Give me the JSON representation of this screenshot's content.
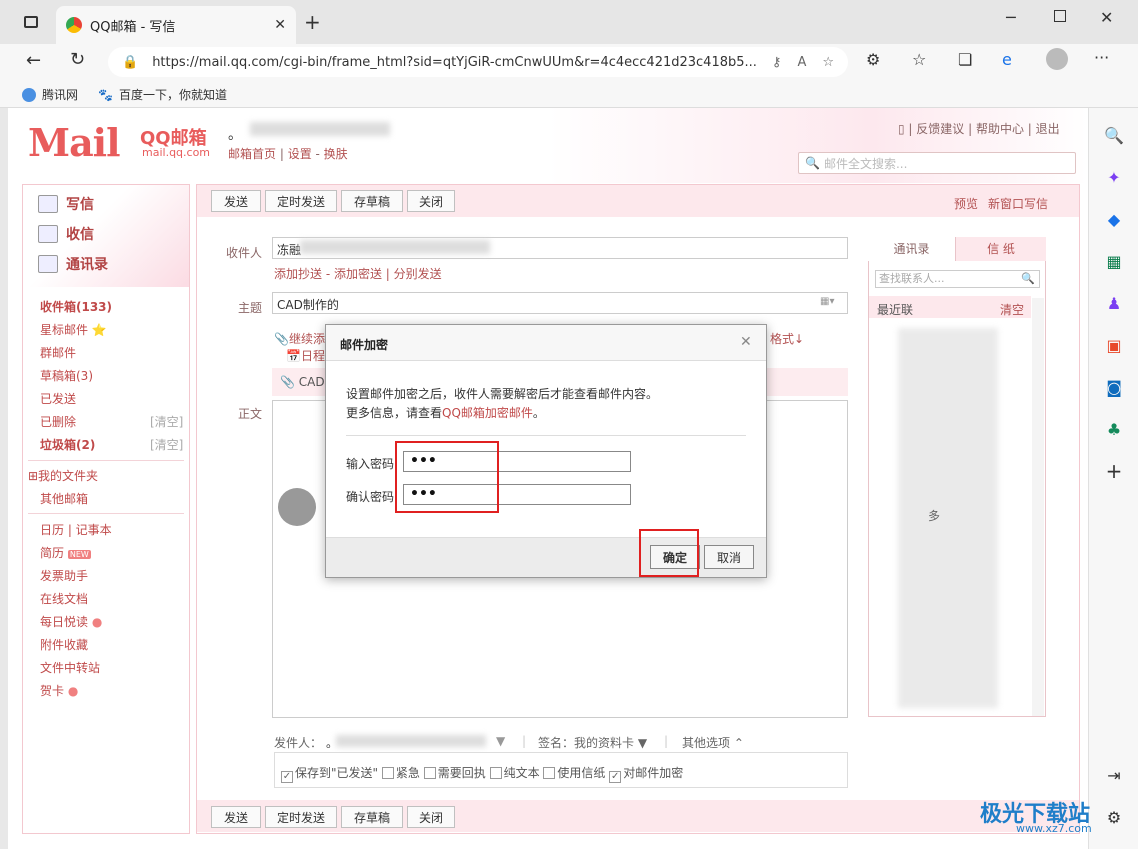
{
  "browser": {
    "tab_title": "QQ邮箱 - 写信",
    "url": "https://mail.qq.com/cgi-bin/frame_html?sid=qtYjGiR-cmCnwUUm&r=4c4ecc421d23c418b5...",
    "bookmarks": [
      "腾讯网",
      "百度一下，你就知道"
    ]
  },
  "header": {
    "logo": "Mail",
    "logo_cn": "QQ邮箱",
    "logo_domain": "mail.qq.com",
    "dot": "。",
    "nav": [
      "邮箱首页",
      "设置",
      "换肤"
    ],
    "top_links": [
      "反馈建议",
      "帮助中心",
      "退出"
    ],
    "search_placeholder": "邮件全文搜索..."
  },
  "sidebar": {
    "write": "写信",
    "receive": "收信",
    "contacts": "通讯录",
    "items": [
      {
        "label": "收件箱(133)",
        "bold": true
      },
      {
        "label": "星标邮件 ⭐"
      },
      {
        "label": "群邮件"
      },
      {
        "label": "草稿箱(3)"
      },
      {
        "label": "已发送"
      },
      {
        "label": "已删除",
        "extra": "[清空]"
      },
      {
        "label": "垃圾箱(2)",
        "bold": true,
        "extra": "[清空]"
      }
    ],
    "folders": [
      "⊞我的文件夹",
      "其他邮箱"
    ],
    "tools": [
      "日历 | 记事本",
      "简历",
      "发票助手",
      "在线文档",
      "每日悦读",
      "附件收藏",
      "文件中转站",
      "贺卡"
    ],
    "new_badge": "NEW"
  },
  "compose": {
    "toolbar": [
      "发送",
      "定时发送",
      "存草稿",
      "关闭"
    ],
    "toolbar_right": [
      "预览",
      "新窗口写信"
    ],
    "to_label": "收件人",
    "to_value": "冻融",
    "cc_links": "添加抄送 - 添加密送 | 分别发送",
    "subject_label": "主题",
    "subject_value": "CAD制作的",
    "attach_link": "继续添",
    "format": "格式↓",
    "schedule": "日程",
    "attach_cad": "CAD",
    "body_label": "正文",
    "sender_label": "发件人：",
    "sender_value": "。",
    "signature": "签名：我的资料卡 ▼",
    "other_options": "其他选项 ⌃",
    "options": [
      {
        "label": "保存到\"已发送\"",
        "checked": true
      },
      {
        "label": "紧急",
        "checked": false
      },
      {
        "label": "需要回执",
        "checked": false
      },
      {
        "label": "纯文本",
        "checked": false
      },
      {
        "label": "使用信纸",
        "checked": false
      },
      {
        "label": "对邮件加密",
        "checked": true
      }
    ]
  },
  "contacts_panel": {
    "tabs": [
      "通讯录",
      "信 纸"
    ],
    "search_placeholder": "查找联系人...",
    "recent": "最近联",
    "clear": "清空",
    "more": "多"
  },
  "modal": {
    "title": "邮件加密",
    "line1": "设置邮件加密之后，收件人需要解密后才能查看邮件内容。",
    "line2_prefix": "更多信息，请查看",
    "line2_link": "QQ邮箱加密邮件",
    "line2_suffix": "。",
    "pwd_label": "输入密码",
    "pwd_value": "•••",
    "confirm_label": "确认密码",
    "confirm_value": "•••",
    "ok": "确定",
    "cancel": "取消"
  },
  "watermark": {
    "text": "极光下载站",
    "url": "www.xz7.com"
  }
}
